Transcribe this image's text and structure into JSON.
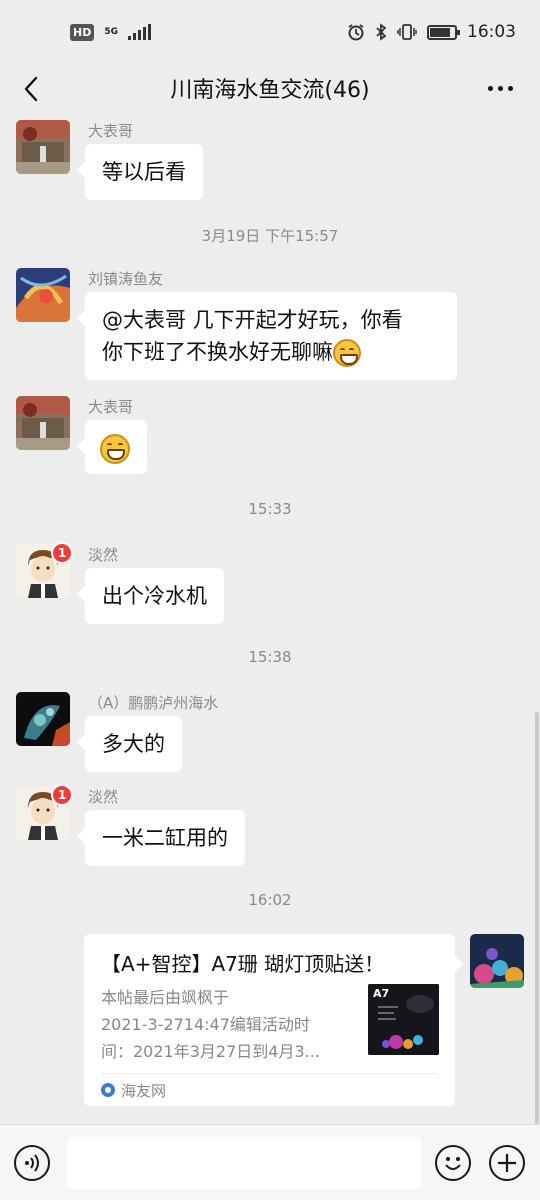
{
  "status_bar": {
    "hd": "HD",
    "network": "5G",
    "time": "16:03"
  },
  "nav": {
    "title": "川南海水鱼交流(46)"
  },
  "messages": [
    {
      "sender": "大表哥",
      "text": "等以后看"
    },
    {
      "timestamp": "3月19日 下午15:57"
    },
    {
      "sender": "刘镇涛鱼友",
      "line1": "@大表哥  几下开起才好玩，你看",
      "line2": "你下班了不换水好无聊嘛"
    },
    {
      "sender": "大表哥",
      "emoji": "grinning-face"
    },
    {
      "timestamp": "15:33"
    },
    {
      "sender": "淡然",
      "badge": "1",
      "text": "出个冷水机"
    },
    {
      "timestamp": "15:38"
    },
    {
      "sender": "（A）鹏鹏泸州海水",
      "text": "多大的"
    },
    {
      "sender": "淡然",
      "badge": "1",
      "text": "一米二缸用的"
    },
    {
      "timestamp": "16:02"
    }
  ],
  "link_card": {
    "title": "【A+智控】A7珊 瑚灯顶贴送！",
    "desc_line1": "本帖最后由飒枫于",
    "desc_line2": "2021-3-2714:47编辑活动时",
    "desc_line3": "间：2021年3月27日到4月3...",
    "thumb_label": "A7",
    "source": "海友网"
  },
  "colors": {
    "bubble": "#ffffff",
    "background": "#ededed",
    "badge": "#f03c3c"
  },
  "icons": [
    "back-icon",
    "more-icon",
    "voice-icon",
    "emoji-icon",
    "plus-icon",
    "alarm-icon",
    "bluetooth-icon",
    "vibrate-icon",
    "battery-icon",
    "signal-icon"
  ]
}
